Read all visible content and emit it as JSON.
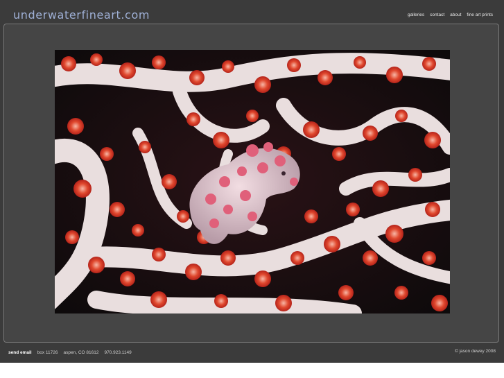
{
  "site": {
    "title": "underwaterfineart.com"
  },
  "nav": {
    "items": [
      {
        "label": "galleries"
      },
      {
        "label": "contact"
      },
      {
        "label": "about"
      },
      {
        "label": "fine art prints"
      }
    ]
  },
  "footer": {
    "send_email": "send email",
    "box": "box 11726",
    "city": "aspen, CO  81612",
    "phone": "970.923.1149",
    "copyright": "© jason dewey 2008"
  },
  "colors": {
    "page_bg": "#3b3b3b",
    "frame_bg": "#454545",
    "title": "#9fb0d6"
  }
}
